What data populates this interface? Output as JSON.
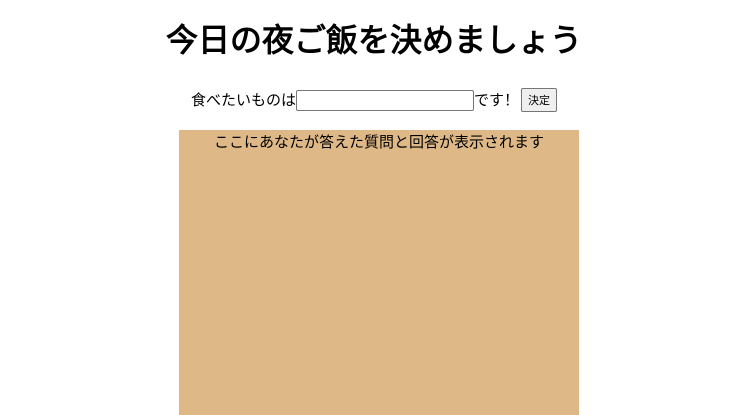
{
  "header": {
    "title": "今日の夜ご飯を決めましょう"
  },
  "form": {
    "prefix_label": "食べたいものは",
    "input_value": "",
    "suffix_label": "です！",
    "submit_label": "決定"
  },
  "result": {
    "text": "ここにあなたが答えた質問と回答が表示されます",
    "background_color": "#deb887"
  }
}
